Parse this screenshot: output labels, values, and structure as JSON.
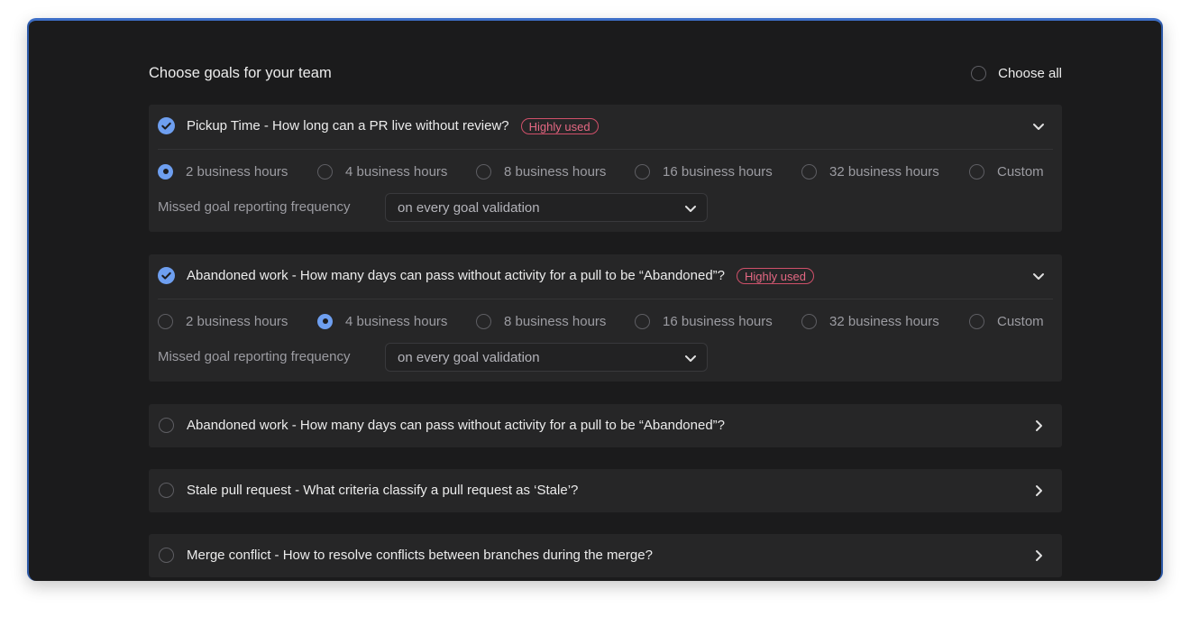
{
  "header": {
    "title": "Choose goals for your team",
    "choose_all_label": "Choose all"
  },
  "goals": [
    {
      "title": "Pickup Time - How long can a PR live without review?",
      "badge": "Highly used",
      "checked": true,
      "expanded": true,
      "options": [
        "2 business hours",
        "4 business hours",
        "8 business hours",
        "16 business hours",
        "32 business hours",
        "Custom"
      ],
      "selected_option": "2 business hours",
      "frequency_label": "Missed goal reporting frequency",
      "frequency_value": "on every goal validation"
    },
    {
      "title": "Abandoned work - How many days can pass without activity for a pull to be “Abandoned”?",
      "badge": "Highly used",
      "checked": true,
      "expanded": true,
      "options": [
        "2 business hours",
        "4 business hours",
        "8 business hours",
        "16 business hours",
        "32 business hours",
        "Custom"
      ],
      "selected_option": "4 business hours",
      "frequency_label": "Missed goal reporting frequency",
      "frequency_value": "on every goal validation"
    },
    {
      "title": "Abandoned work - How many days can pass without activity for a pull to be “Abandoned”?",
      "checked": false,
      "expanded": false
    },
    {
      "title": "Stale pull request - What criteria classify a pull request as ‘Stale’?",
      "checked": false,
      "expanded": false
    },
    {
      "title": "Merge conflict - How to resolve conflicts between branches during the merge?",
      "checked": false,
      "expanded": false
    }
  ],
  "colors": {
    "background": "#1b1b1c",
    "card": "#262627",
    "accent": "#6e9ff0",
    "badge": "#e46883",
    "frame": "#3d6ec6"
  },
  "icons": {
    "checked": "check-circle-icon",
    "expanded": "chevron-down-icon",
    "collapsed": "chevron-right-icon",
    "select_caret": "chevron-down-icon"
  }
}
